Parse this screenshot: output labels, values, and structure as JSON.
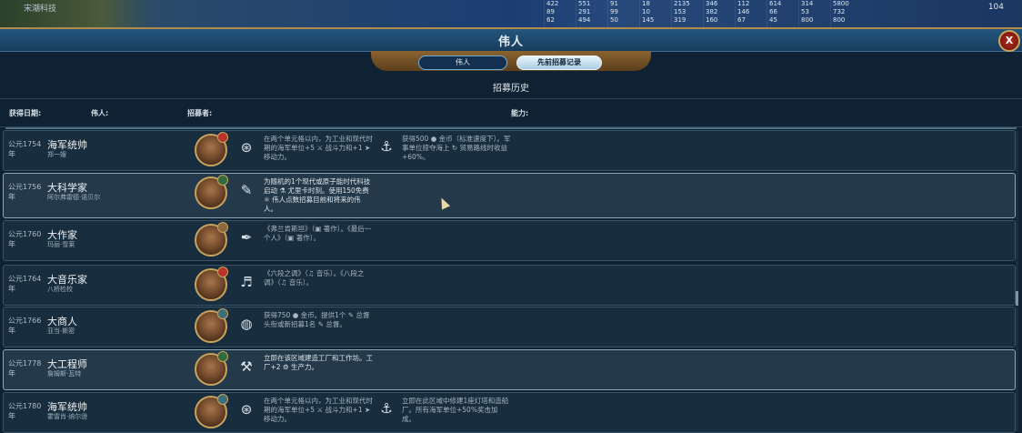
{
  "hud": {
    "civ_name": "宋潮科技",
    "stats": [
      [
        "422",
        "89",
        "62"
      ],
      [
        "551",
        "291",
        "494"
      ],
      [
        "91",
        "99",
        "50"
      ],
      [
        "18",
        "10",
        "145"
      ],
      [
        "2135",
        "153",
        "319"
      ],
      [
        "346",
        "382",
        "160"
      ],
      [
        "112",
        "146",
        "67"
      ],
      [
        "614",
        "66",
        "45"
      ],
      [
        "314",
        "53",
        "800"
      ],
      [
        "5800",
        "732",
        "800"
      ]
    ],
    "turn": "104"
  },
  "window": {
    "title": "伟人",
    "close_label": "X",
    "tabs": [
      {
        "label": "伟人",
        "active": false
      },
      {
        "label": "先前招募记录",
        "active": true
      }
    ],
    "subheading": "招募历史"
  },
  "columns": {
    "date": "获得日期:",
    "person": "伟人:",
    "recruiter": "招募者:",
    "ability": "能力:"
  },
  "rows": [
    {
      "date": "公元1754 年",
      "type": "海军统帅",
      "name": "郑一嫂",
      "badge_color": "#b8332a",
      "icon": "anchor-badge-icon",
      "icon_glyph": "⊛",
      "desc": "在两个单元格以内，为工业和现代时期的海军单位+5 ⚔ 战斗力和+1 ➤ 移动力。",
      "icon2": "ship-wheel-icon",
      "icon2_glyph": "⚓",
      "desc2": "获得500 ● 金币（标准速度下）。军事单位掠夺海上 ↻ 贸易路线时收益+60%。",
      "highlight": false
    },
    {
      "date": "公元1756 年",
      "type": "大科学家",
      "name": "阿尔弗雷德·诺贝尔",
      "badge_color": "#2f6b3c",
      "icon": "science-scroll-icon",
      "icon_glyph": "✎",
      "desc": "为随机的1个现代或原子能时代科技启动 ⚗ 尤里卡时刻。使用150免费 ⚛ 伟人点数招募目前和将来的伟人。",
      "icon2": "",
      "icon2_glyph": "",
      "desc2": "",
      "highlight": true
    },
    {
      "date": "公元1760 年",
      "type": "大作家",
      "name": "玛丽·雪莱",
      "badge_color": "#8a6a3e",
      "icon": "quill-icon",
      "icon_glyph": "✒",
      "desc": "《弗兰肯斯坦》（▣ 著作）。《最后一个人》（▣ 著作）。",
      "icon2": "",
      "icon2_glyph": "",
      "desc2": "",
      "highlight": false
    },
    {
      "date": "公元1764 年",
      "type": "大音乐家",
      "name": "八桥检校",
      "badge_color": "#b8332a",
      "icon": "music-note-icon",
      "icon_glyph": "♬",
      "desc": "《六段之调》（♫ 音乐）。《八段之调》（♫ 音乐）。",
      "icon2": "",
      "icon2_glyph": "",
      "desc2": "",
      "highlight": false
    },
    {
      "date": "公元1766 年",
      "type": "大商人",
      "name": "亚当·斯密",
      "badge_color": "#3c6f7a",
      "icon": "merchant-coin-icon",
      "icon_glyph": "◍",
      "desc": "获得750 ● 金币。提供1个 ✎ 总督头衔或新招募1名 ✎ 总督。",
      "icon2": "",
      "icon2_glyph": "",
      "desc2": "",
      "highlight": false
    },
    {
      "date": "公元1778 年",
      "type": "大工程师",
      "name": "詹姆斯·瓦特",
      "badge_color": "#2f6b3c",
      "icon": "tools-icon",
      "icon_glyph": "⚒",
      "desc": "立即在该区域建造工厂和工作坊。工厂+2 ⚙ 生产力。",
      "icon2": "",
      "icon2_glyph": "",
      "desc2": "",
      "highlight": true
    },
    {
      "date": "公元1780 年",
      "type": "海军统帅",
      "name": "霍雷肖·纳尔逊",
      "badge_color": "#3c6f7a",
      "icon": "anchor-badge-icon",
      "icon_glyph": "⊛",
      "desc": "在两个单元格以内，为工业和现代时期的海军单位+5 ⚔ 战斗力和+1 ➤ 移动力。",
      "icon2": "ship-wheel-icon",
      "icon2_glyph": "⚓",
      "desc2": "立即在此区域中修建1座灯塔和造船厂。所有海军单位+50%奖击加成。",
      "highlight": false
    }
  ]
}
